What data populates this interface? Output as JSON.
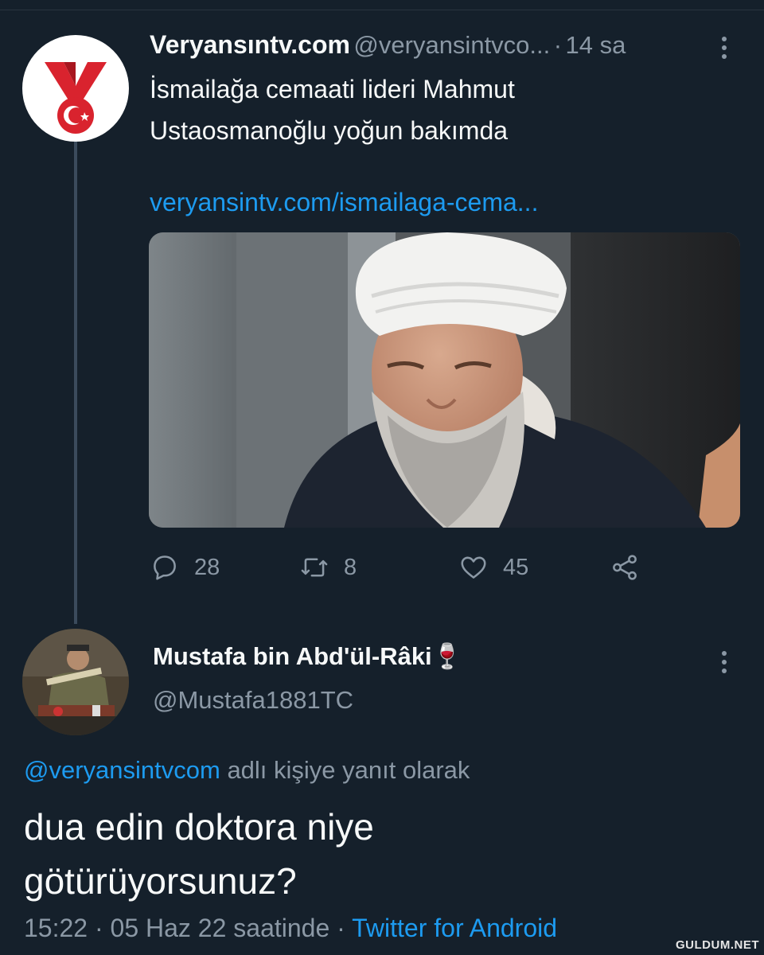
{
  "tweet": {
    "author_name": "Veryansıntv.com",
    "handle": "@veryansintvco...",
    "separator": "·",
    "time": "14 sa",
    "text_lines": [
      "İsmailağa cemaati lideri Mahmut",
      "Ustaosmanoğlu yoğun bakımda"
    ],
    "link": "veryansintv.com/ismailaga-cema...",
    "actions": {
      "replies": "28",
      "retweets": "8",
      "likes": "45"
    }
  },
  "reply": {
    "author_name": "Mustafa bin Abd'ül-Râki",
    "author_emoji": "🍷",
    "handle": "@Mustafa1881TC",
    "reply_to_mention": "@veryansintvcom",
    "reply_to_suffix": " adlı kişiye yanıt olarak",
    "text_lines": [
      "dua edin doktora niye",
      "götürüyorsunuz?"
    ],
    "timestamp": "15:22 · 05 Haz 22 saatinde · ",
    "client": "Twitter for Android"
  },
  "watermark": "GULDUM.NET",
  "icons": [
    "reply-icon",
    "retweet-icon",
    "like-icon",
    "share-icon",
    "more-icon"
  ],
  "colors": {
    "background": "#15202b",
    "accent": "#1d9bf0",
    "muted": "#8b98a5",
    "brand_red": "#d9232e"
  }
}
